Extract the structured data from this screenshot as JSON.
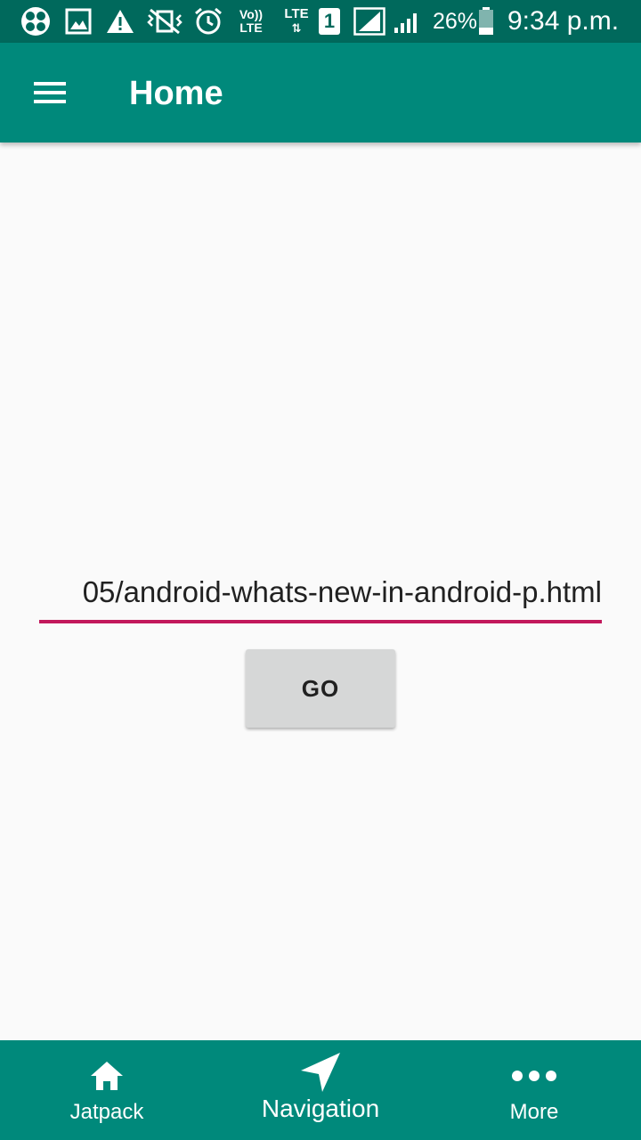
{
  "status_bar": {
    "battery_percent": "26%",
    "sim_slot": "1",
    "network_lte": "LTE",
    "volte_top": "Vo))",
    "volte_bottom": "LTE",
    "time": "9:34 p.m."
  },
  "app_bar": {
    "title": "Home",
    "menu_icon": "hamburger-menu-icon"
  },
  "url_input": {
    "value": "05/android-whats-new-in-android-p.html"
  },
  "go_button": {
    "label": "GO"
  },
  "bottom_nav": {
    "items": [
      {
        "label": "Jatpack",
        "icon": "home-icon"
      },
      {
        "label": "Navigation",
        "icon": "navigation-arrow-icon",
        "active": true
      },
      {
        "label": "More",
        "icon": "more-horizontal-icon"
      }
    ]
  },
  "colors": {
    "status_bar": "#00695c",
    "app_bar": "#00897b",
    "accent_underline": "#c2185b",
    "button_bg": "#d6d7d7",
    "background": "#fafafa"
  }
}
